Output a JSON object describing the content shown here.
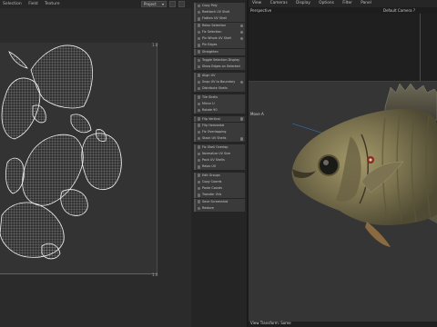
{
  "uv_editor": {
    "menu": [
      "Selection",
      "Field",
      "Texture"
    ],
    "project_select": "Project",
    "coord_u1": "1.0",
    "coord_v1": "1.0"
  },
  "palette": {
    "items": [
      "Copy Poly",
      "Reattach UV Shell",
      "Flatten UV Shell",
      "Relax Selection",
      "Fix Selection",
      "Pin Whole UV Shell",
      "Pin Edges",
      "Straighten",
      "Toggle Selection Display",
      "Show Edges on Selected",
      "Align UV",
      "Snap UV to Boundary",
      "Distribute Shells",
      "Tile Shells",
      "Mirror U",
      "Rotate 90",
      "Flip Vertical",
      "Flip Horizontal",
      "Fix Overlapping",
      "Stack UV Shells",
      "Fix Shell Overlap",
      "Normalize UV Size",
      "Pack UV Shells",
      "Relax UV",
      "Edit Groups",
      "Copy Coords",
      "Paste Coords",
      "Transfer UVs",
      "Save Screenshot",
      "Restore"
    ]
  },
  "viewport": {
    "menu": [
      "View",
      "Cameras",
      "Display",
      "Options",
      "Filter",
      "Panel"
    ],
    "perspective_label": "Perspective",
    "camera_label": "Default Camera ?",
    "view_label": "Move A",
    "status_text": "View Transform: Some"
  }
}
